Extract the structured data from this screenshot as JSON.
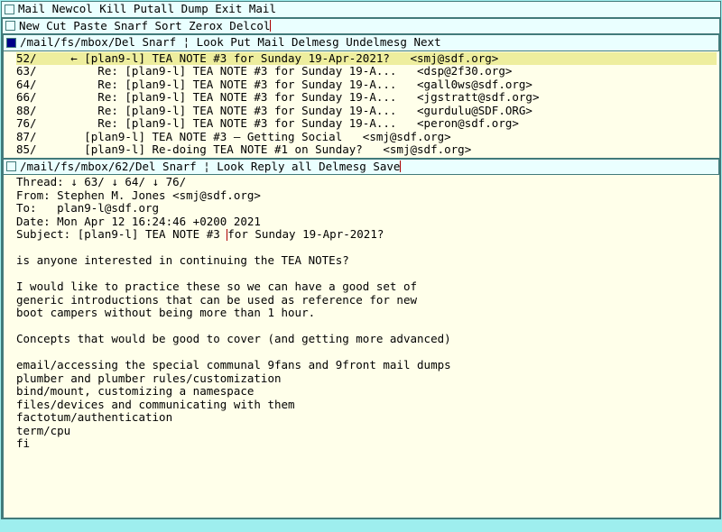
{
  "main_tag": "Mail Newcol Kill Putall Dump Exit Mail",
  "col_tag": "New Cut Paste Snarf Sort Zerox Delcol ",
  "mbox_tag_path": "/mail/fs/mbox/",
  "mbox_tag_cmds": " Del Snarf ¦ Look Put Mail Delmesg Undelmesg Next",
  "messages": [
    {
      "n": "52/",
      "ind": "    ← ",
      "subj": "[plan9-l] TEA NOTE #3 for Sunday 19-Apr-2021?",
      "from": "<smj@sdf.org>",
      "sel": true
    },
    {
      "n": "63/",
      "ind": "        ",
      "subj": "Re: [plan9-l] TEA NOTE #3 for Sunday 19-A...",
      "from": "<dsp@2f30.org>",
      "sel": false
    },
    {
      "n": "64/",
      "ind": "        ",
      "subj": "Re: [plan9-l] TEA NOTE #3 for Sunday 19-A...",
      "from": "<gall0ws@sdf.org>",
      "sel": false
    },
    {
      "n": "66/",
      "ind": "        ",
      "subj": "Re: [plan9-l] TEA NOTE #3 for Sunday 19-A...",
      "from": "<jgstratt@sdf.org>",
      "sel": false
    },
    {
      "n": "88/",
      "ind": "        ",
      "subj": "Re: [plan9-l] TEA NOTE #3 for Sunday 19-A...",
      "from": "<gurdulu@SDF.ORG>",
      "sel": false
    },
    {
      "n": "76/",
      "ind": "        ",
      "subj": "Re: [plan9-l] TEA NOTE #3 for Sunday 19-A...",
      "from": "<peron@sdf.org>",
      "sel": false
    },
    {
      "n": "87/",
      "ind": "      ",
      "subj": "[plan9-l] TEA NOTE #3 – Getting Social",
      "from": "<smj@sdf.org>",
      "sel": false
    },
    {
      "n": "85/",
      "ind": "      ",
      "subj": "[plan9-l] Re-doing TEA NOTE #1 on Sunday?",
      "from": "<smj@sdf.org>",
      "sel": false
    }
  ],
  "msg_tag_path": "/mail/fs/mbox/62/",
  "msg_tag_cmds": " Del Snarf ¦ Look Reply all Delmesg Save ",
  "thread_line": "Thread: ↓ 63/ ↓ 64/ ↓ 76/",
  "from_line": "From: Stephen M. Jones <smj@sdf.org>",
  "to_line": "To:   plan9-l@sdf.org",
  "date_line": "Date: Mon Apr 12 16:24:46 +0200 2021",
  "subject_pre": "Subject: [plan9-l] TEA NOTE #3 ",
  "subject_post": "for Sunday 19-Apr-2021?",
  "body_text": "is anyone interested in continuing the TEA NOTEs?\n\nI would like to practice these so we can have a good set of\ngeneric introductions that can be used as reference for new\nboot campers without being more than 1 hour.\n\nConcepts that would be good to cover (and getting more advanced)\n\nemail/accessing the special communal 9fans and 9front mail dumps\nplumber and plumber rules/customization\nbind/mount, customizing a namespace\nfiles/devices and communicating with them\nfactotum/authentication\nterm/cpu\nfi"
}
